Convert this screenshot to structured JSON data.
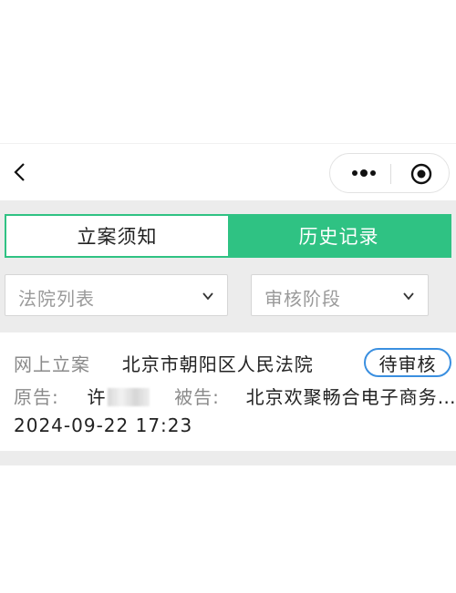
{
  "nav": {
    "back_icon": "chevron-left-icon",
    "more_icon": "more-dots-icon",
    "close_icon": "target-icon"
  },
  "tabs": [
    {
      "label": "立案须知",
      "active": false
    },
    {
      "label": "历史记录",
      "active": true
    }
  ],
  "filters": {
    "court": {
      "placeholder": "法院列表"
    },
    "stage": {
      "placeholder": "审核阶段"
    }
  },
  "case": {
    "type_label": "网上立案",
    "court_name": "北京市朝阳区人民法院",
    "status": "待审核",
    "plaintiff_label": "原告:",
    "plaintiff_value": "许",
    "defendant_label": "被告:",
    "defendant_value": "北京欢聚畅合电子商务…",
    "datetime": "2024-09-22 17:23"
  },
  "colors": {
    "accent_green": "#2fc283",
    "badge_blue": "#3a8fe0"
  }
}
